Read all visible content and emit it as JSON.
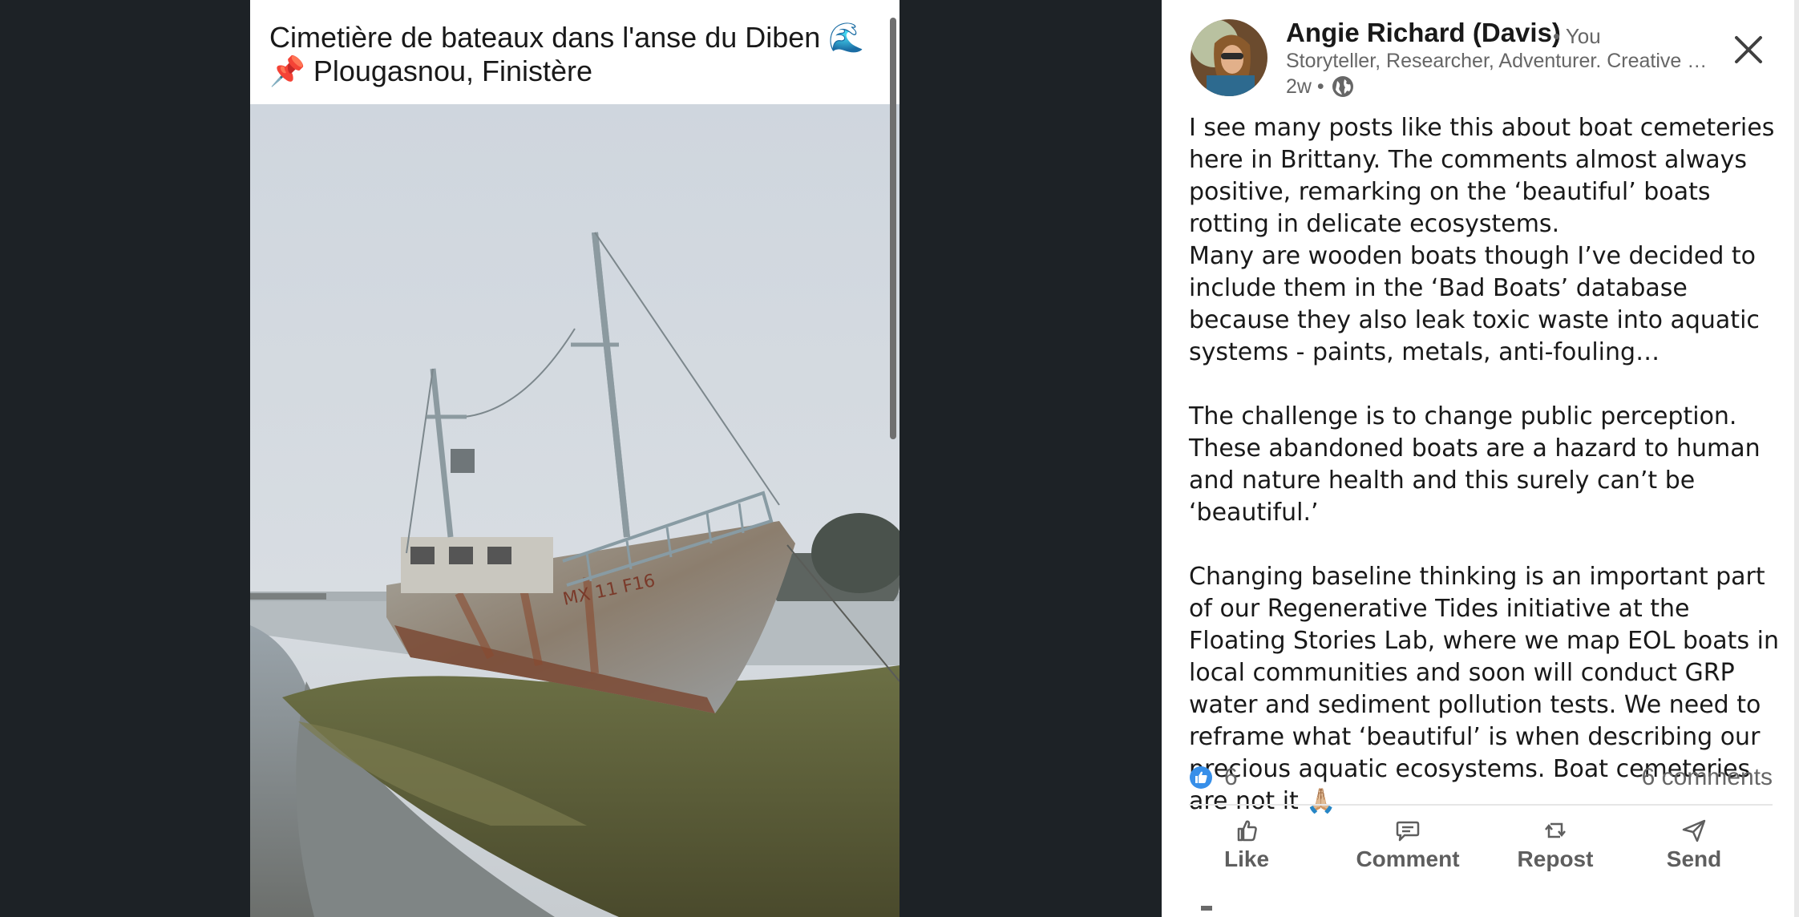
{
  "media": {
    "caption": "Cimetière de bateaux dans l'anse du Diben 🌊\n📌 Plougasnou, Finistère",
    "photo_icon": "boat-photo",
    "hull_marking": "MX 11 F16"
  },
  "author": {
    "name": "Angie Richard (Davis)",
    "badge": "• You",
    "headline": "Storyteller, Researcher, Adventurer. Creative Director, Floating Stories Lab",
    "time": "2w •",
    "visibility_icon": "globe-icon",
    "avatar_icon": "profile-photo"
  },
  "post": {
    "paragraph_1_line_1": "I see many posts like this about boat cemeteries here in Brittany. The comments almost always positive, remarking on the ‘beautiful’ boats rotting in delicate ecosystems.",
    "paragraph_1_line_2": "Many are wooden boats though I’ve decided to include them in the ‘Bad Boats’ database because they also leak toxic waste into aquatic systems - paints, metals, anti-fouling…",
    "paragraph_2": "The challenge is to change public perception. These abandoned boats are a hazard to human and nature health and this surely can’t be ‘beautiful.’",
    "paragraph_3": "Changing baseline thinking is an important part of our Regenerative Tides initiative at the Floating Stories Lab, where we map EOL boats in local communities and soon will conduct GRP water and sediment pollution tests. We need to reframe what ‘beautiful’ is when describing our precious aquatic ecosystems. Boat cemeteries are not it 🙏🏼"
  },
  "social": {
    "reaction_icon": "like-reaction-icon",
    "reaction_count": "6",
    "comments": "6 comments"
  },
  "actions": {
    "like": "Like",
    "comment": "Comment",
    "repost": "Repost",
    "send": "Send"
  },
  "colors": {
    "backdrop": "#1d2226",
    "panel": "#ffffff",
    "text": "#191919",
    "muted": "#666666",
    "like_blue": "#378fe9"
  }
}
